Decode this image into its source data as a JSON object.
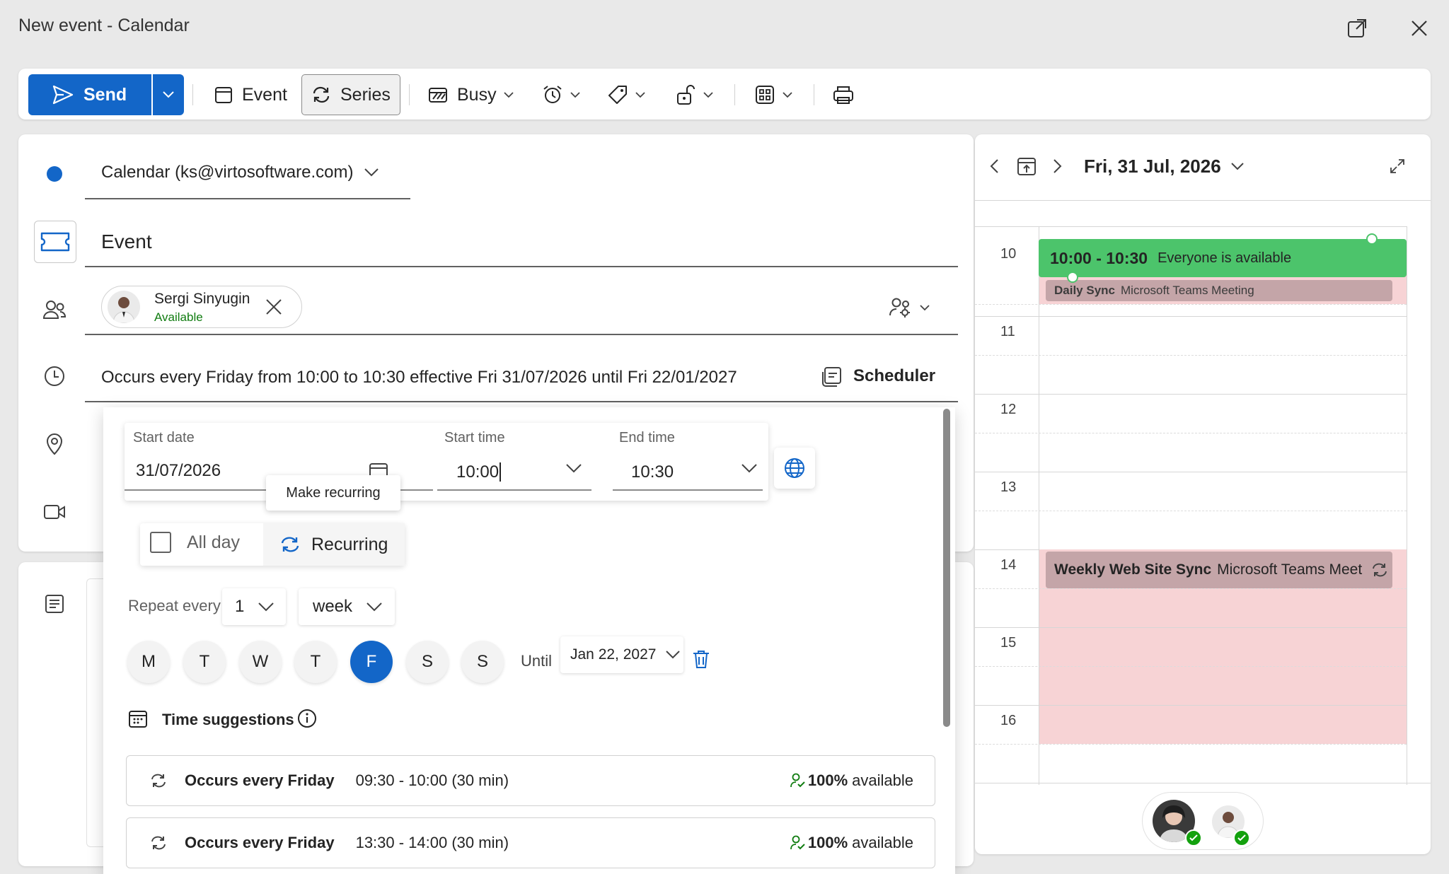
{
  "window": {
    "title": "New event - Calendar"
  },
  "ribbon": {
    "send_label": "Send",
    "event_label": "Event",
    "series_label": "Series",
    "busy_label": "Busy"
  },
  "form": {
    "calendar_select": "Calendar (ks@virtosoftware.com)",
    "title_value": "Event",
    "attendee_name": "Sergi Sinyugin",
    "attendee_status": "Available",
    "recurrence_summary": "Occurs every Friday from 10:00 to 10:30 effective Fri 31/07/2026 until Fri 22/01/2027",
    "scheduler_label": "Scheduler"
  },
  "recurrence": {
    "start_date_label": "Start date",
    "start_date_value": "31/07/2026",
    "start_time_label": "Start time",
    "start_time_value": "10:00",
    "end_time_label": "End time",
    "end_time_value": "10:30",
    "tooltip": "Make recurring",
    "all_day_label": "All day",
    "recurring_label": "Recurring",
    "repeat_every_label": "Repeat every",
    "repeat_interval": "1",
    "repeat_unit": "week",
    "days": [
      "M",
      "T",
      "W",
      "T",
      "F",
      "S",
      "S"
    ],
    "selected_day_index": 4,
    "until_label": "Until",
    "until_value": "Jan 22, 2027",
    "time_suggestions_label": "Time suggestions",
    "suggestions": [
      {
        "title": "Occurs every Friday",
        "time": "09:30 - 10:00 (30 min)",
        "pct": "100%",
        "avail": "available"
      },
      {
        "title": "Occurs every Friday",
        "time": "13:30 - 14:00 (30 min)",
        "pct": "100%",
        "avail": "available"
      }
    ]
  },
  "day_view": {
    "date_label": "Fri, 31 Jul, 2026",
    "hours": [
      "10",
      "11",
      "12",
      "13",
      "14",
      "15",
      "16"
    ],
    "events": {
      "main_time": "10:00 - 10:30",
      "main_status": "Everyone is available",
      "daily_title": "Daily Sync",
      "daily_sub": "Microsoft Teams Meeting",
      "weekly_title": "Weekly Web Site Sync",
      "weekly_sub": "Microsoft Teams Meet"
    }
  },
  "colors": {
    "accent": "#1366c8",
    "available_green": "#4cc46b",
    "busy_pink": "#f7d3d5",
    "event_mauve": "#c4a5a8"
  }
}
